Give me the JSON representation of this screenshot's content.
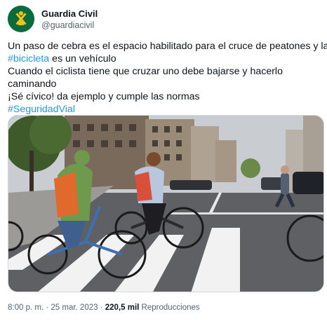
{
  "account": {
    "display_name": "Guardia Civil",
    "handle": "@guardiacivil",
    "avatar_icon": "guardia-civil-emblem-icon",
    "brand_color": "#0b6b3a"
  },
  "tweet": {
    "line1": "Un paso de cebra es el espacio habilitado para el cruce de peatones y la",
    "hashtag_bicicleta": "#bicicleta",
    "line2_rest": " es un vehículo",
    "line3": "Cuando el ciclista tiene que cruzar uno debe bajarse y hacerlo",
    "line4": "caminando",
    "line5": "¡Sé cívico! da ejemplo y cumple las normas",
    "hashtag_seguridad": "#SeguridadVial",
    "link_color": "#1d9bf0"
  },
  "meta": {
    "time": "8:00 p. m.",
    "separator": " · ",
    "date": "25 mar. 2023",
    "views_count": "220,5 mil",
    "views_label": " Reproducciones"
  }
}
